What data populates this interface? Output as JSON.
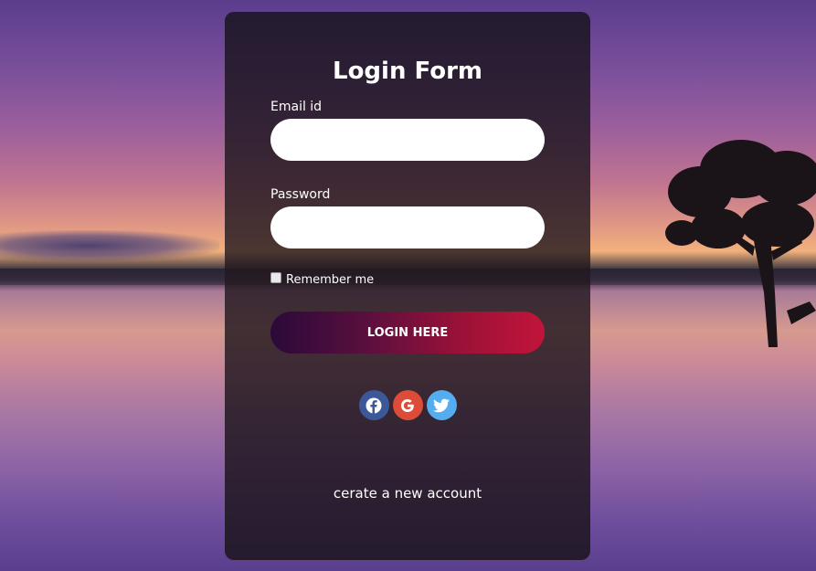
{
  "form": {
    "title": "Login Form",
    "email_label": "Email id",
    "email_value": "",
    "password_label": "Password",
    "password_value": "",
    "remember_label": "Remember me",
    "remember_checked": false,
    "login_button": "LOGIN HERE",
    "create_account_link": "cerate a new account"
  },
  "social": [
    {
      "name": "facebook-icon",
      "color": "#3b5998"
    },
    {
      "name": "google-icon",
      "color": "#dd4b39"
    },
    {
      "name": "twitter-icon",
      "color": "#55acee"
    }
  ]
}
